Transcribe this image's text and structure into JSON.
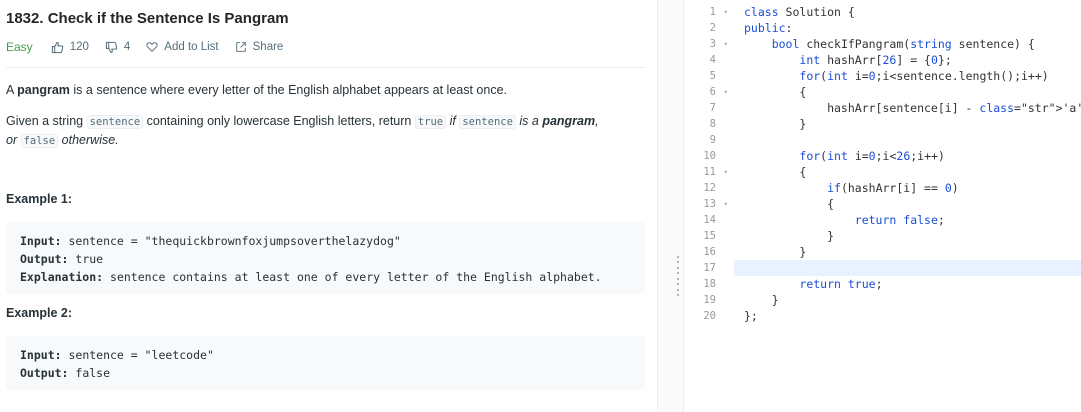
{
  "problem": {
    "title": "1832. Check if the Sentence Is Pangram",
    "difficulty": "Easy",
    "likes": "120",
    "dislikes": "4",
    "add_to_list": "Add to List",
    "share": "Share"
  },
  "description": {
    "p1_a": "A ",
    "p1_b": "pangram",
    "p1_c": " is a sentence where every letter of the English alphabet appears at least once.",
    "p2_a": "Given a string ",
    "p2_code1": "sentence",
    "p2_b": " containing only lowercase English letters, return ",
    "p2_code2": "true",
    "p2_c": " if ",
    "p2_code3": "sentence",
    "p2_d": " is a ",
    "p2_e": "pangram",
    "p2_f": ",",
    "p2_g": "or ",
    "p2_code4": "false",
    "p2_h": " otherwise."
  },
  "examples": [
    {
      "heading": "Example 1:",
      "input_label": "Input:",
      "input_value": " sentence = \"thequickbrownfoxjumpsoverthelazydog\"",
      "output_label": "Output:",
      "output_value": " true",
      "explanation_label": "Explanation:",
      "explanation_value": " sentence contains at least one of every letter of the English alphabet."
    },
    {
      "heading": "Example 2:",
      "input_label": "Input:",
      "input_value": " sentence = \"leetcode\"",
      "output_label": "Output:",
      "output_value": " false"
    }
  ],
  "editor": {
    "line_numbers": [
      "1",
      "2",
      "3",
      "4",
      "5",
      "6",
      "7",
      "8",
      "9",
      "10",
      "11",
      "12",
      "13",
      "14",
      "15",
      "16",
      "17",
      "18",
      "19",
      "20"
    ],
    "fold_lines": [
      "1",
      "3",
      "6",
      "11",
      "13"
    ],
    "lines": [
      "class Solution {",
      "public:",
      "    bool checkIfPangram(string sentence) {",
      "        int hashArr[26] = {0};",
      "        for(int i=0;i<sentence.length();i++)",
      "        {",
      "            hashArr[sentence[i] - 'a']++;",
      "        }",
      "",
      "        for(int i=0;i<26;i++)",
      "        {",
      "            if(hashArr[i] == 0)",
      "            {",
      "                return false;",
      "            }",
      "        }",
      "",
      "        return true;",
      "    }",
      "};"
    ],
    "active_line": "17"
  },
  "colors": {
    "easy": "#43a047",
    "keyword": "#1a4fd6",
    "active_line": "#e8f2ff"
  }
}
